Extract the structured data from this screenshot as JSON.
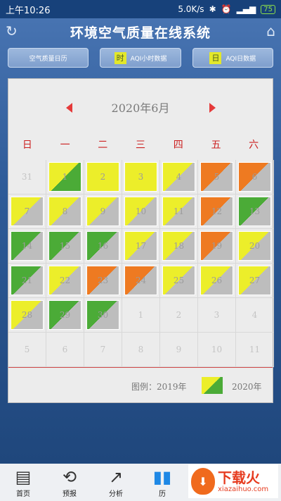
{
  "status_bar": {
    "time": "上午10:26",
    "network_speed": "5.0K/s",
    "battery": "75"
  },
  "app": {
    "title": "环境空气质量在线系统"
  },
  "tabs": [
    {
      "label": "空气质量日历",
      "badge": ""
    },
    {
      "label": "AQI小时数据",
      "badge": "时"
    },
    {
      "label": "AQI日数据",
      "badge": "日"
    }
  ],
  "calendar": {
    "month_label": "2020年6月",
    "weekdays": [
      "日",
      "一",
      "二",
      "三",
      "四",
      "五",
      "六"
    ],
    "colors": {
      "green": "#4bab37",
      "yellow": "#ecee2a",
      "orange": "#ee7a21",
      "gray": "#bdbdbd"
    },
    "days": [
      {
        "num": "31",
        "in_month": false
      },
      {
        "num": "1",
        "in_month": true,
        "top": "yellow",
        "bottom": "green"
      },
      {
        "num": "2",
        "in_month": true,
        "top": "yellow",
        "bottom": "yellow"
      },
      {
        "num": "3",
        "in_month": true,
        "top": "yellow",
        "bottom": "yellow"
      },
      {
        "num": "4",
        "in_month": true,
        "top": "yellow",
        "bottom": "gray"
      },
      {
        "num": "5",
        "in_month": true,
        "top": "orange",
        "bottom": "gray"
      },
      {
        "num": "6",
        "in_month": true,
        "top": "orange",
        "bottom": "gray"
      },
      {
        "num": "7",
        "in_month": true,
        "top": "yellow",
        "bottom": "gray"
      },
      {
        "num": "8",
        "in_month": true,
        "top": "yellow",
        "bottom": "gray"
      },
      {
        "num": "9",
        "in_month": true,
        "top": "yellow",
        "bottom": "gray"
      },
      {
        "num": "10",
        "in_month": true,
        "top": "yellow",
        "bottom": "gray"
      },
      {
        "num": "11",
        "in_month": true,
        "top": "yellow",
        "bottom": "gray"
      },
      {
        "num": "12",
        "in_month": true,
        "top": "orange",
        "bottom": "gray"
      },
      {
        "num": "13",
        "in_month": true,
        "top": "green",
        "bottom": "gray"
      },
      {
        "num": "14",
        "in_month": true,
        "top": "green",
        "bottom": "gray"
      },
      {
        "num": "15",
        "in_month": true,
        "top": "green",
        "bottom": "gray"
      },
      {
        "num": "16",
        "in_month": true,
        "top": "green",
        "bottom": "gray"
      },
      {
        "num": "17",
        "in_month": true,
        "top": "yellow",
        "bottom": "gray"
      },
      {
        "num": "18",
        "in_month": true,
        "top": "yellow",
        "bottom": "gray"
      },
      {
        "num": "19",
        "in_month": true,
        "top": "orange",
        "bottom": "gray"
      },
      {
        "num": "20",
        "in_month": true,
        "top": "yellow",
        "bottom": "gray"
      },
      {
        "num": "21",
        "in_month": true,
        "top": "green",
        "bottom": "gray"
      },
      {
        "num": "22",
        "in_month": true,
        "top": "yellow",
        "bottom": "gray"
      },
      {
        "num": "23",
        "in_month": true,
        "top": "orange",
        "bottom": "gray"
      },
      {
        "num": "24",
        "in_month": true,
        "top": "orange",
        "bottom": "gray"
      },
      {
        "num": "25",
        "in_month": true,
        "top": "yellow",
        "bottom": "gray"
      },
      {
        "num": "26",
        "in_month": true,
        "top": "yellow",
        "bottom": "gray"
      },
      {
        "num": "27",
        "in_month": true,
        "top": "yellow",
        "bottom": "gray"
      },
      {
        "num": "28",
        "in_month": true,
        "top": "yellow",
        "bottom": "gray"
      },
      {
        "num": "29",
        "in_month": true,
        "top": "green",
        "bottom": "gray"
      },
      {
        "num": "30",
        "in_month": true,
        "top": "green",
        "bottom": "gray"
      },
      {
        "num": "1",
        "in_month": false
      },
      {
        "num": "2",
        "in_month": false
      },
      {
        "num": "3",
        "in_month": false
      },
      {
        "num": "4",
        "in_month": false
      },
      {
        "num": "5",
        "in_month": false
      },
      {
        "num": "6",
        "in_month": false
      },
      {
        "num": "7",
        "in_month": false
      },
      {
        "num": "8",
        "in_month": false
      },
      {
        "num": "9",
        "in_month": false
      },
      {
        "num": "10",
        "in_month": false
      },
      {
        "num": "11",
        "in_month": false
      }
    ]
  },
  "legend": {
    "prefix": "图例：",
    "year_a": "2019年",
    "year_b": "2020年"
  },
  "bottom_nav": [
    {
      "label": "首页",
      "icon": "home-list-icon"
    },
    {
      "label": "预报",
      "icon": "history-clock-icon"
    },
    {
      "label": "分析",
      "icon": "trend-chart-icon"
    },
    {
      "label": "历",
      "icon": "bar-chart-icon",
      "active": true
    }
  ],
  "watermark": {
    "title": "下载火",
    "sub": "xiazaihuo.com"
  }
}
